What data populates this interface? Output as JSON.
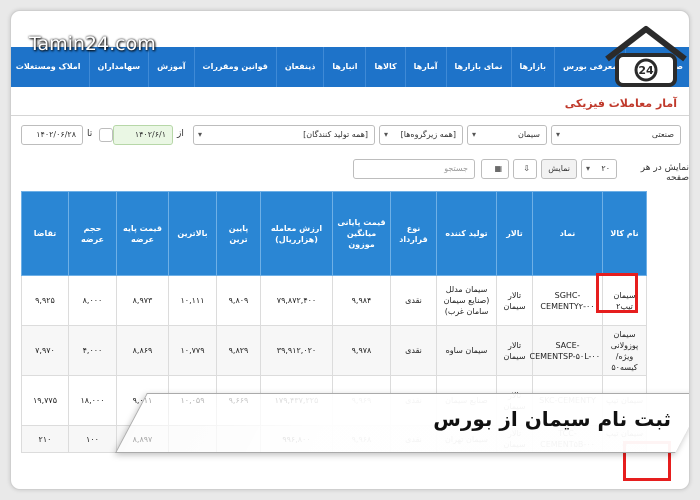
{
  "watermark": "Tamin24.com",
  "logo": {
    "name": "tamin-logo",
    "number": "24"
  },
  "nav": [
    "صفحه اصلی",
    "معرفی بورس",
    "بازارها",
    "نمای بازارها",
    "آمارها",
    "کالاها",
    "انبارها",
    "ذینفعان",
    "قوانین ومقررات",
    "آموزش",
    "سهامداران",
    "املاک ومستغلات"
  ],
  "heading": "آمار معاملات فیزیکی",
  "filters": {
    "group": "صنعتی",
    "commodity": "سیمان",
    "subgroup": "[همه زیرگروه‌ها]",
    "producers": "[همه تولید کنندگان]",
    "from_label": "از",
    "from_date": "۱۴۰۲/۶/۱",
    "to_label": "تا",
    "to_date": "۱۴۰۲/۰۶/۲۸",
    "page_size_label": "نمایش در هر صفحه",
    "page_size": "۲۰",
    "show_button": "نمایش",
    "search_placeholder": "جستجو"
  },
  "columns": [
    "نام کالا",
    "نماد",
    "تالار",
    "تولید کننده",
    "نوع قرارداد",
    "قیمت پایانی میانگین موزون",
    "ارزش معامله (هزارریال)",
    "پایین ترین",
    "بالاترین",
    "قیمت پایه عرضه",
    "حجم عرضه",
    "تقاضا"
  ],
  "rows": [
    [
      "سیمان تیپ۲",
      "SGHC-CEMENTY۲-۰۰",
      "تالار سیمان",
      "سیمان مدلل (صنایع سیمان سامان غرب)",
      "نقدی",
      "۹,۹۸۴",
      "۷۹,۸۷۲,۴۰۰",
      "۹,۸۰۹",
      "۱۰,۱۱۱",
      "۸,۹۷۳",
      "۸,۰۰۰",
      "۹,۹۲۵"
    ],
    [
      "سیمان پوزولانی ویژه/ کیسه۵۰",
      "SACE-CEMENTSP-۵۰L-۰۰",
      "تالار سیمان",
      "سیمان ساوه",
      "نقدی",
      "۹,۹۷۸",
      "۳۹,۹۱۲,۰۲۰",
      "۹,۸۲۹",
      "۱۰,۷۷۹",
      "۸,۸۶۹",
      "۴,۰۰۰",
      "۷,۹۷۰"
    ],
    [
      "سیمان تیپ",
      "SKC-CEMENTY",
      "تالار سیمان",
      "صنایع سیمان",
      "نقدی",
      "۹,۹۶۹",
      "۱۷۹,۴۳۷,۲۲۵",
      "۹,۶۶۹",
      "۱۰,۰۵۹",
      "۹,۰۱۱",
      "۱۸,۰۰۰",
      "۱۹,۷۷۵"
    ],
    [
      "سیمان تیپ ۵",
      "TCC-CEMENT۵B-۰۰",
      "تالار سیمان",
      "سیمان تهران",
      "نقدی",
      "۹,۹۶۸",
      "۹۹۶,۸۰۰",
      "",
      "",
      "۸,۸۹۷",
      "۱۰۰",
      "۲۱۰"
    ]
  ],
  "banner": "ثبت نام سیمان از بورس",
  "colors": {
    "nav": "#1e73c9",
    "header": "#2a86d4",
    "highlight": "#e61e1e",
    "heading": "#c0392b"
  }
}
